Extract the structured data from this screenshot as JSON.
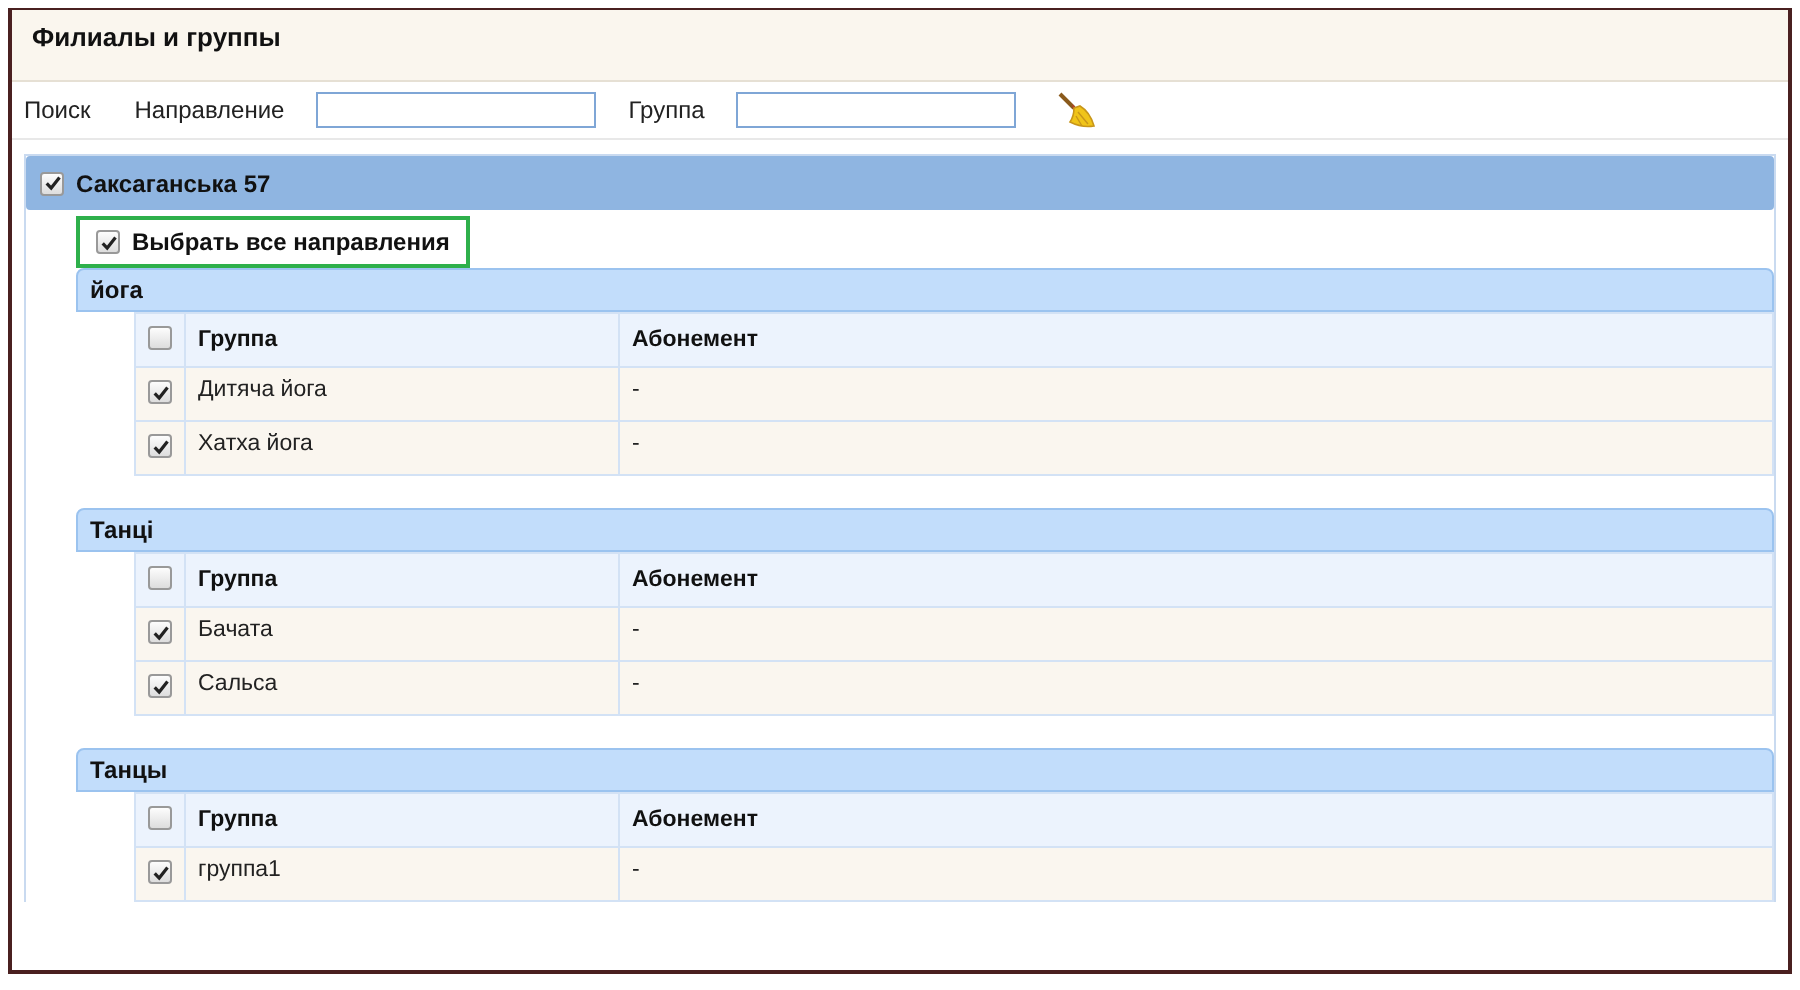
{
  "title": "Филиалы и группы",
  "search": {
    "label": "Поиск",
    "fields": [
      {
        "label": "Направление"
      },
      {
        "label": "Группа"
      }
    ]
  },
  "branches": [
    {
      "name": "Саксаганська 57",
      "checked": true,
      "select_all": {
        "label": "Выбрать все направления",
        "checked": true,
        "highlighted": true
      },
      "directions": [
        {
          "name": "йога",
          "header_checked": false,
          "columns": [
            "Группа",
            "Абонемент"
          ],
          "rows": [
            {
              "checked": true,
              "cells": [
                "Дитяча йога",
                "-"
              ]
            },
            {
              "checked": true,
              "cells": [
                "Хатха йога",
                "-"
              ]
            }
          ]
        },
        {
          "name": "Танці",
          "header_checked": false,
          "columns": [
            "Группа",
            "Абонемент"
          ],
          "rows": [
            {
              "checked": true,
              "cells": [
                "Бачата",
                "-"
              ]
            },
            {
              "checked": true,
              "cells": [
                "Сальса",
                "-"
              ]
            }
          ]
        },
        {
          "name": "Танцы",
          "header_checked": false,
          "columns": [
            "Группа",
            "Абонемент"
          ],
          "rows": [
            {
              "checked": true,
              "cells": [
                "группа1",
                "-"
              ]
            }
          ]
        }
      ]
    }
  ]
}
